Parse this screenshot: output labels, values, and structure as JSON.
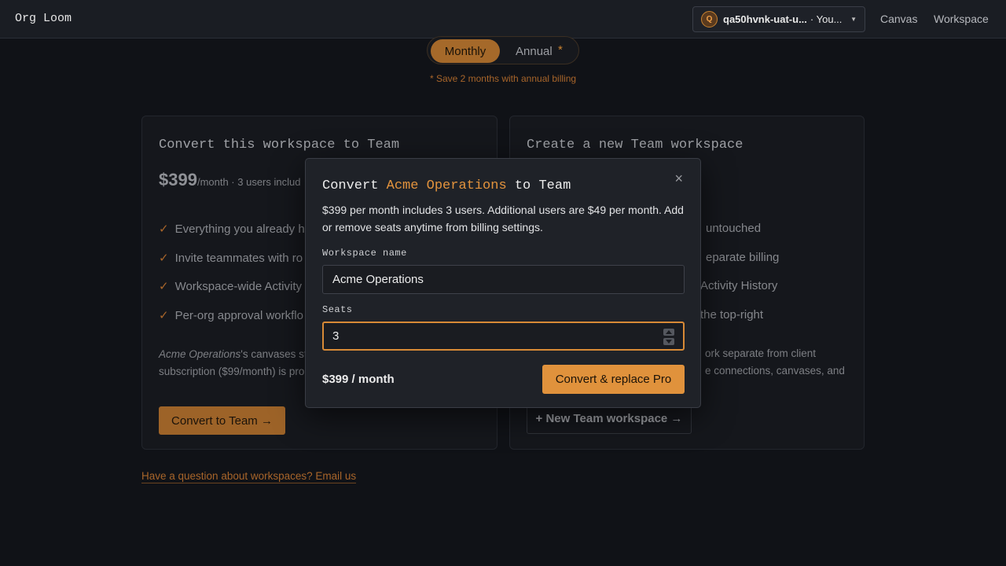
{
  "header": {
    "brand": "Org Loom",
    "account": {
      "avatar_letter": "Q",
      "name": "qa50hvnk-uat-u...",
      "suffix": "· You..."
    },
    "nav": [
      "Canvas",
      "Workspace"
    ]
  },
  "billing_toggle": {
    "monthly_label": "Monthly",
    "annual_label": "Annual",
    "annual_marker": "*",
    "selected": "Monthly",
    "note": "* Save 2 months with annual billing"
  },
  "convert_card": {
    "title": "Convert this workspace to Team",
    "price": "$399",
    "price_suffix": "/month · 3 users includ",
    "features": [
      "Everything you already h",
      "Invite teammates with ro",
      "Workspace-wide Activity",
      "Per-org approval workflo"
    ],
    "desc_italic": "Acme Operations",
    "desc_line1": "'s canvases sta",
    "desc_line2": "subscription ($99/month) is pro",
    "button": "Convert to Team →"
  },
  "new_card": {
    "title": "Create a new Team workspace",
    "features": [
      "untouched",
      "eparate billing",
      "Activity History",
      "the top-right"
    ],
    "desc_line1": "ork separate from client",
    "desc_line2": "e connections, canvases, and",
    "button": "+ New Team workspace →"
  },
  "footer_link": "Have a question about workspaces? Email us",
  "modal": {
    "title_prefix": "Convert",
    "title_workspace": "Acme Operations",
    "title_suffix": "to Team",
    "close": "×",
    "description": "$399 per month includes 3 users. Additional users are $49 per month. Add or remove seats anytime from billing settings.",
    "workspace_name_label": "Workspace name",
    "workspace_name_value": "Acme Operations",
    "seats_label": "Seats",
    "seats_value": "3",
    "total": "$399 / month",
    "primary_button": "Convert & replace Pro"
  },
  "colors": {
    "accent": "#e0923c",
    "background": "#101217",
    "modal": "#1f2228"
  }
}
